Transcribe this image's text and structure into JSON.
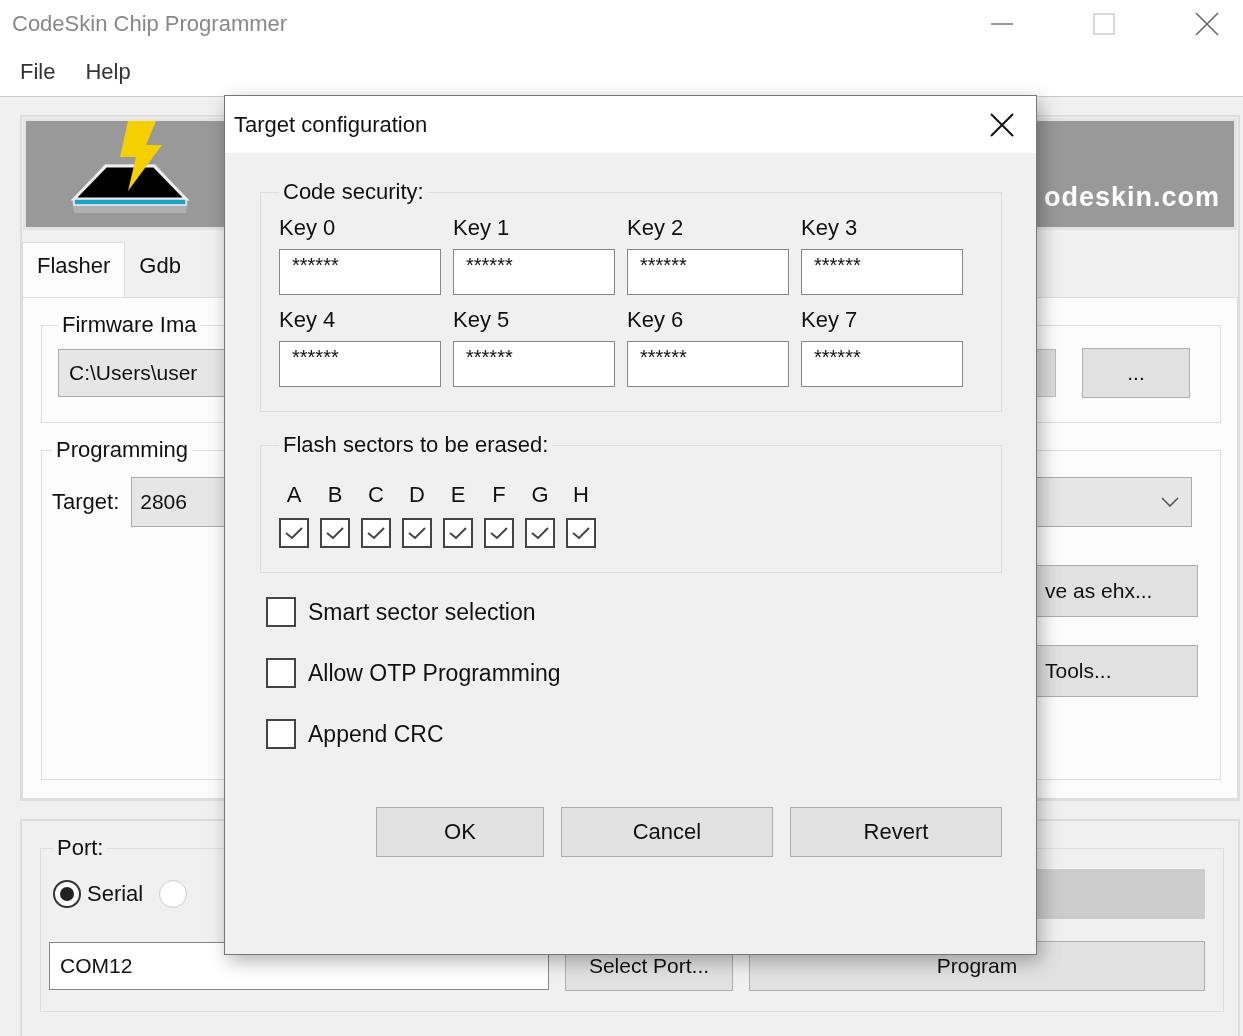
{
  "window": {
    "title": "CodeSkin Chip Programmer"
  },
  "menu": [
    "File",
    "Help"
  ],
  "banner": {
    "website": "odeskin.com"
  },
  "tabs": [
    {
      "label": "Flasher",
      "selected": true
    },
    {
      "label": "Gdb",
      "selected": false
    }
  ],
  "firmware_group": {
    "title": "Firmware Ima",
    "path": "C:\\Users\\user",
    "browse_button": "..."
  },
  "programming_group": {
    "title": "Programming",
    "target_label": "Target:",
    "target_value": "2806",
    "buttons": [
      "ve as ehx...",
      "Tools..."
    ]
  },
  "port_group": {
    "title": "Port:",
    "radios": [
      {
        "label": "Serial",
        "selected": true
      },
      {
        "selected": false
      }
    ],
    "port_value": "COM12",
    "select_port_button": "Select Port...",
    "program_button": "Program"
  },
  "dialog": {
    "title": "Target configuration",
    "code_security": {
      "title": "Code security:",
      "keys": [
        {
          "label": "Key 0",
          "value": "******"
        },
        {
          "label": "Key 1",
          "value": "******"
        },
        {
          "label": "Key 2",
          "value": "******"
        },
        {
          "label": "Key 3",
          "value": "******"
        },
        {
          "label": "Key 4",
          "value": "******"
        },
        {
          "label": "Key 5",
          "value": "******"
        },
        {
          "label": "Key 6",
          "value": "******"
        },
        {
          "label": "Key 7",
          "value": "******"
        }
      ]
    },
    "flash_sectors": {
      "title": "Flash sectors to be erased:",
      "sectors": [
        {
          "label": "A",
          "checked": true
        },
        {
          "label": "B",
          "checked": true
        },
        {
          "label": "C",
          "checked": true
        },
        {
          "label": "D",
          "checked": true
        },
        {
          "label": "E",
          "checked": true
        },
        {
          "label": "F",
          "checked": true
        },
        {
          "label": "G",
          "checked": true
        },
        {
          "label": "H",
          "checked": true
        }
      ]
    },
    "options": [
      {
        "label": "Smart sector selection",
        "checked": false
      },
      {
        "label": "Allow OTP Programming",
        "checked": false
      },
      {
        "label": "Append CRC",
        "checked": false
      }
    ],
    "buttons": [
      "OK",
      "Cancel",
      "Revert"
    ]
  }
}
